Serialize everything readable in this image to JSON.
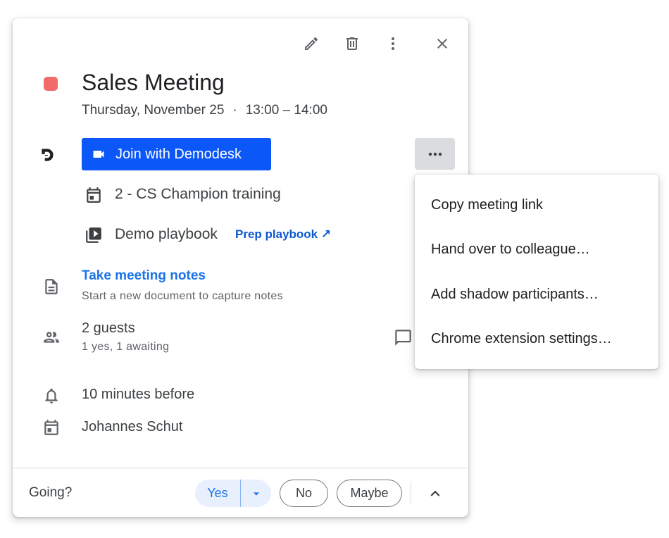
{
  "event": {
    "title": "Sales Meeting",
    "date": "Thursday, November 25",
    "separator": "·",
    "time": "13:00 – 14:00",
    "color": "#f26b6b"
  },
  "toolbar": {
    "edit_icon": "pencil-icon",
    "delete_icon": "trash-icon",
    "more_icon": "more-vert-icon",
    "close_icon": "close-icon"
  },
  "demodesk": {
    "join_label": "Join with Demodesk",
    "template": "2 - CS Champion training",
    "playbook": "Demo playbook",
    "prep_playbook": "Prep playbook ↗"
  },
  "notes": {
    "link": "Take meeting notes",
    "subtitle": "Start a new document to capture notes"
  },
  "guests": {
    "count": "2 guests",
    "summary": "1 yes, 1 awaiting"
  },
  "reminder": "10 minutes before",
  "organizer": "Johannes Schut",
  "rsvp": {
    "label": "Going?",
    "yes": "Yes",
    "no": "No",
    "maybe": "Maybe"
  },
  "menu": {
    "items": [
      "Copy meeting link",
      "Hand over to colleague…",
      "Add shadow participants…",
      "Chrome extension settings…"
    ]
  }
}
